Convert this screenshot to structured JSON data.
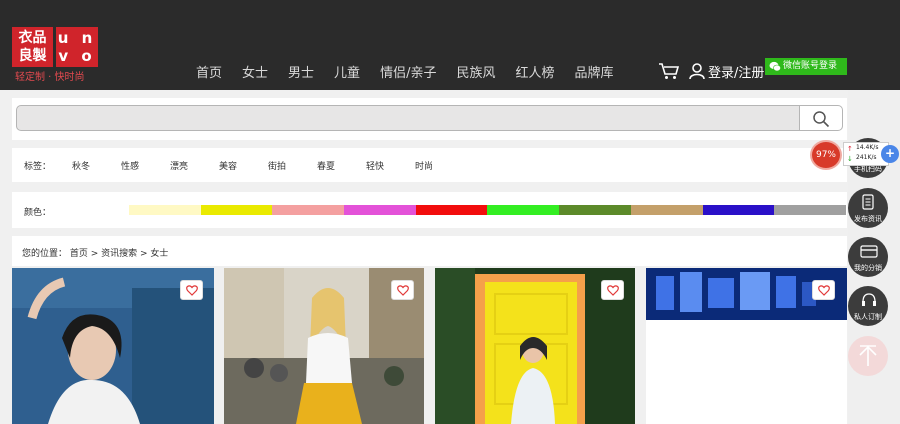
{
  "brand": {
    "logo_left": "衣品\n良製",
    "logo_right": "u n\nv o",
    "tagline": "轻定制 · 快时尚"
  },
  "nav": {
    "items": [
      "首页",
      "女士",
      "男士",
      "儿童",
      "情侣/亲子",
      "民族风",
      "红人榜",
      "品牌库"
    ]
  },
  "account": {
    "login_text": "登录/注册",
    "wechat_login": "微信账号登录"
  },
  "search": {
    "placeholder": "",
    "icon": "search-icon"
  },
  "tags": {
    "label": "标签：",
    "items": [
      "秋冬",
      "性感",
      "漂亮",
      "美容",
      "街拍",
      "春夏",
      "轻快",
      "时尚"
    ]
  },
  "colors": {
    "label": "颜色：",
    "swatches": [
      "#fff9c4",
      "#eaea00",
      "#f4a0a0",
      "#e352d8",
      "#f20d0d",
      "#33ee22",
      "#5c8a2a",
      "#c4a06a",
      "#2a10c8",
      "#a0a0a0"
    ]
  },
  "breadcrumb": {
    "text": "您的位置： 首页 > 资讯搜索 > 女士"
  },
  "sidebar": {
    "items": [
      {
        "label": "手机扫码",
        "icon": "phone-icon"
      },
      {
        "label": "发布资讯",
        "icon": "document-icon"
      },
      {
        "label": "我的分销",
        "icon": "card-icon"
      },
      {
        "label": "私人订制",
        "icon": "headset-icon"
      }
    ],
    "top_icon": "arrow-up-icon"
  },
  "speed_widget": {
    "percent": "97%",
    "up": "14.4K/s",
    "down": "241K/s"
  },
  "colors_theme": {
    "header_bg": "#2b2b2b",
    "brand_red": "#d0242b",
    "wechat_green": "#2fb91b"
  }
}
